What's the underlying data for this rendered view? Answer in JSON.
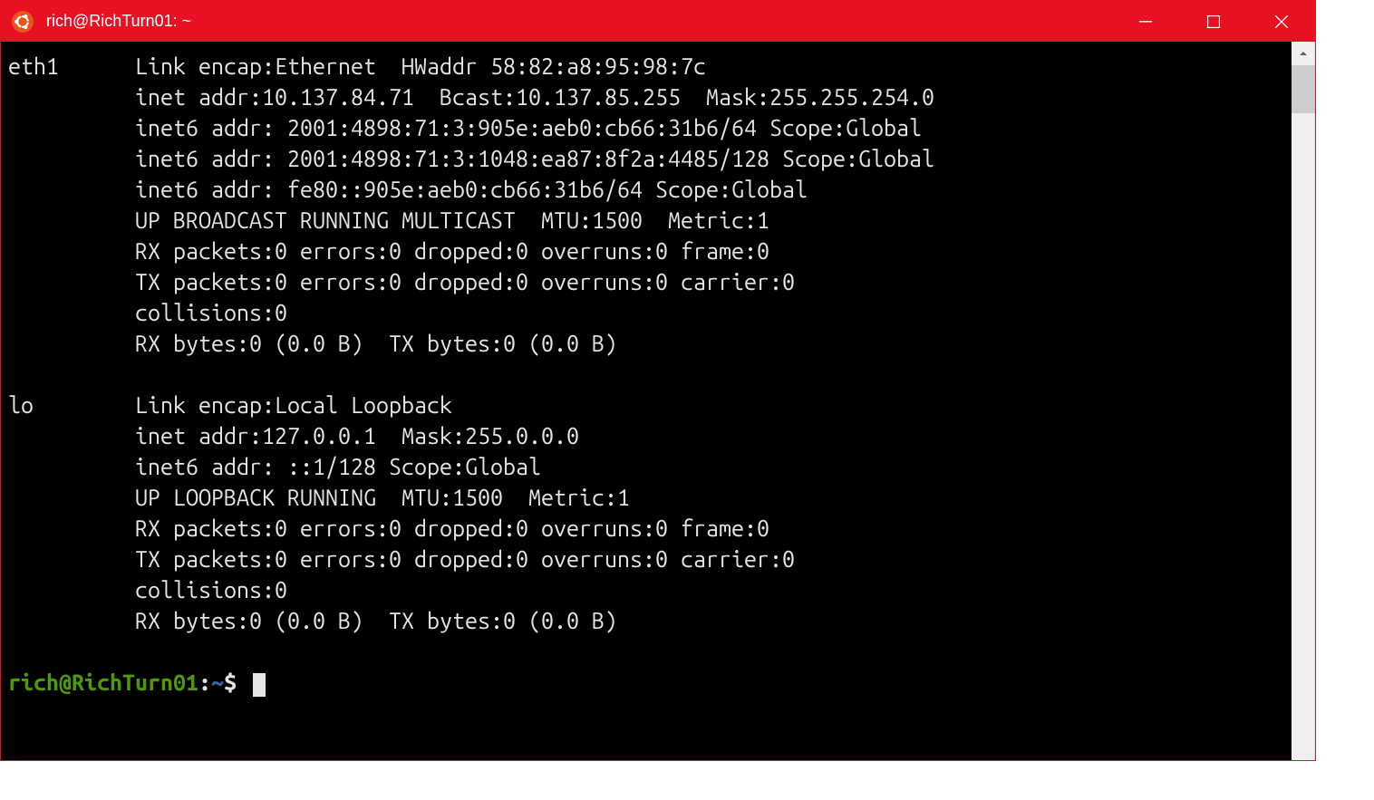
{
  "window": {
    "title": "rich@RichTurn01: ~"
  },
  "terminal": {
    "lines": [
      "eth1      Link encap:Ethernet  HWaddr 58:82:a8:95:98:7c",
      "          inet addr:10.137.84.71  Bcast:10.137.85.255  Mask:255.255.254.0",
      "          inet6 addr: 2001:4898:71:3:905e:aeb0:cb66:31b6/64 Scope:Global",
      "          inet6 addr: 2001:4898:71:3:1048:ea87:8f2a:4485/128 Scope:Global",
      "          inet6 addr: fe80::905e:aeb0:cb66:31b6/64 Scope:Global",
      "          UP BROADCAST RUNNING MULTICAST  MTU:1500  Metric:1",
      "          RX packets:0 errors:0 dropped:0 overruns:0 frame:0",
      "          TX packets:0 errors:0 dropped:0 overruns:0 carrier:0",
      "          collisions:0",
      "          RX bytes:0 (0.0 B)  TX bytes:0 (0.0 B)",
      "",
      "lo        Link encap:Local Loopback",
      "          inet addr:127.0.0.1  Mask:255.0.0.0",
      "          inet6 addr: ::1/128 Scope:Global",
      "          UP LOOPBACK RUNNING  MTU:1500  Metric:1",
      "          RX packets:0 errors:0 dropped:0 overruns:0 frame:0",
      "          TX packets:0 errors:0 dropped:0 overruns:0 carrier:0",
      "          collisions:0",
      "          RX bytes:0 (0.0 B)  TX bytes:0 (0.0 B)",
      ""
    ],
    "prompt": {
      "user_host": "rich@RichTurn01",
      "colon": ":",
      "path": "~",
      "dollar": "$ "
    }
  },
  "colors": {
    "titlebar": "#e81123",
    "terminal_bg": "#000000",
    "terminal_fg": "#e5e5e5",
    "prompt_user": "#4e9a06",
    "prompt_path": "#3465a4"
  }
}
